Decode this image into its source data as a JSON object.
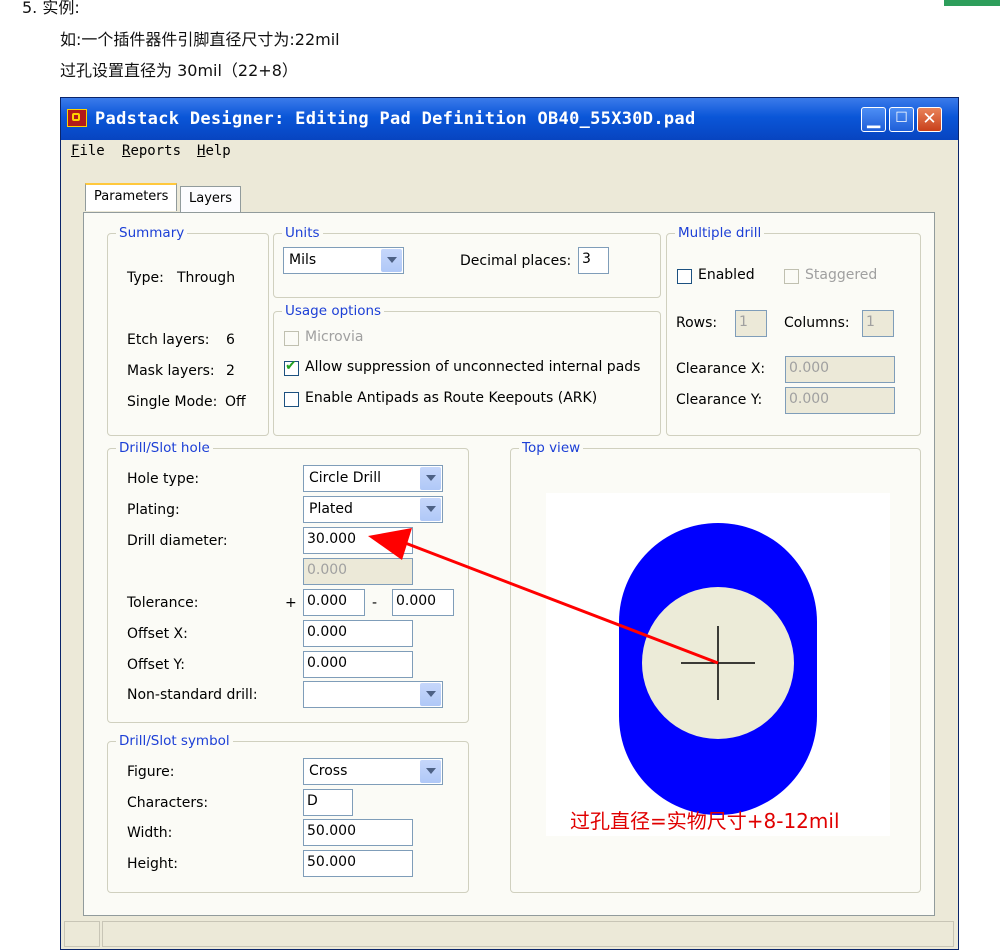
{
  "doc": {
    "line1": "5.  实例:",
    "line2": "如:一个插件器件引脚直径尺寸为:22mil",
    "line3": "过孔设置直径为 30mil（22+8）"
  },
  "window": {
    "title": "Padstack Designer: Editing Pad Definition OB40_55X30D.pad",
    "menu": {
      "file": "File",
      "reports": "Reports",
      "help": "Help"
    },
    "tabs": [
      "Parameters",
      "Layers"
    ],
    "active_tab": "Parameters"
  },
  "summary": {
    "label": "Summary",
    "type_label": "Type:",
    "type_value": "Through",
    "etch_label": "Etch layers:",
    "etch_value": "6",
    "mask_label": "Mask layers:",
    "mask_value": "2",
    "single_label": "Single Mode:",
    "single_value": "Off"
  },
  "units": {
    "label": "Units",
    "value": "Mils",
    "decimal_label": "Decimal places:",
    "decimal_value": "3"
  },
  "usage": {
    "label": "Usage options",
    "microvia": "Microvia",
    "microvia_checked": false,
    "suppress": "Allow suppression of unconnected internal pads",
    "suppress_checked": true,
    "antipads": "Enable Antipads as Route Keepouts (ARK)",
    "antipads_checked": false
  },
  "multi": {
    "label": "Multiple drill",
    "enabled": "Enabled",
    "staggered": "Staggered",
    "rows_label": "Rows:",
    "rows_value": "1",
    "cols_label": "Columns:",
    "cols_value": "1",
    "clrx_label": "Clearance X:",
    "clrx_value": "0.000",
    "clry_label": "Clearance Y:",
    "clry_value": "0.000"
  },
  "drill": {
    "label": "Drill/Slot hole",
    "hole_type_label": "Hole type:",
    "hole_type": "Circle Drill",
    "plating_label": "Plating:",
    "plating": "Plated",
    "diameter_label": "Drill diameter:",
    "diameter": "30.000",
    "diameter2": "0.000",
    "tolerance_label": "Tolerance:",
    "tol_plus": "+",
    "tol_minus": "-",
    "tol_pos": "0.000",
    "tol_neg": "0.000",
    "offx_label": "Offset X:",
    "offx": "0.000",
    "offy_label": "Offset Y:",
    "offy": "0.000",
    "nonstd_label": "Non-standard drill:",
    "nonstd": ""
  },
  "symbol": {
    "label": "Drill/Slot symbol",
    "figure_label": "Figure:",
    "figure": "Cross",
    "chars_label": "Characters:",
    "chars": "D",
    "width_label": "Width:",
    "width": "50.000",
    "height_label": "Height:",
    "height": "50.000"
  },
  "topview": {
    "label": "Top view",
    "annotation": "过孔直径=实物尺寸+8-12mil",
    "pad_color": "#0000ff",
    "hole_color": "#ecebd8",
    "arrow_color": "#ff0000"
  }
}
